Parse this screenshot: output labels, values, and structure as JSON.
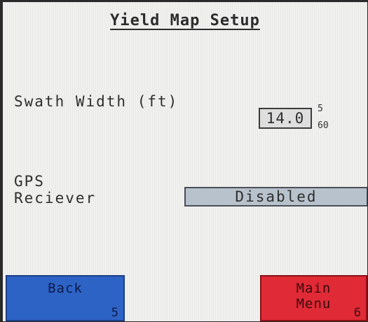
{
  "screen": {
    "title": "Yield Map Setup"
  },
  "swath": {
    "label": "Swath Width (ft)",
    "value": "14.0",
    "max": "5",
    "min": "60"
  },
  "gps": {
    "label_line1": "GPS",
    "label_line2": "Reciever",
    "value": "Disabled"
  },
  "softkeys": {
    "back": {
      "label": "Back",
      "key": "5",
      "color": "#2e63c6"
    },
    "main_menu": {
      "label_line1": "Main",
      "label_line2": "Menu",
      "key": "6",
      "color": "#e02a36"
    }
  }
}
